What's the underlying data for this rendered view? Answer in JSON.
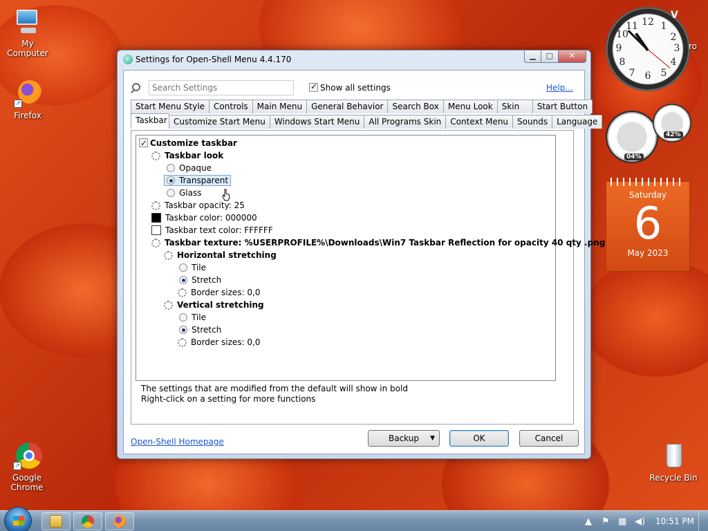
{
  "desktop": {
    "icons": {
      "my_computer": "My Computer",
      "firefox": "Firefox",
      "chrome": "Google Chrome",
      "recycle_bin": "Recycle Bin"
    }
  },
  "gadgets": {
    "clock": {
      "numbers": [
        "12",
        "1",
        "2",
        "3",
        "4",
        "5",
        "6",
        "7",
        "8",
        "9",
        "10",
        "11"
      ],
      "overlay_text": "V",
      "side_text": "ro"
    },
    "meters": {
      "cpu_percent": "04%",
      "memory_percent": "42%"
    },
    "calendar": {
      "weekday": "Saturday",
      "day": "6",
      "month_year": "May 2023"
    }
  },
  "dialog": {
    "title": "Settings for Open-Shell Menu 4.4.170",
    "window_buttons": {
      "minimize": "▁",
      "maximize": "□",
      "close": "✕"
    },
    "search": {
      "placeholder": "Search Settings"
    },
    "show_all": {
      "label": "Show all settings",
      "checked": true
    },
    "help": "Help...",
    "tabs_row1": [
      "Start Menu Style",
      "Controls",
      "Main Menu",
      "General Behavior",
      "Search Box",
      "Menu Look",
      "Skin",
      "Start Button"
    ],
    "tabs_row2": [
      "Taskbar",
      "Customize Start Menu",
      "Windows Start Menu",
      "All Programs Skin",
      "Context Menu",
      "Sounds",
      "Language"
    ],
    "active_tab": "Taskbar",
    "tree": {
      "customize_taskbar": "Customize taskbar",
      "taskbar_look": "Taskbar look",
      "opaque": "Opaque",
      "transparent": "Transparent",
      "glass": "Glass",
      "opacity": "Taskbar opacity: 25",
      "color": "Taskbar color: 000000",
      "text_color": "Taskbar text color: FFFFFF",
      "texture": "Taskbar texture: %USERPROFILE%\\Downloads\\Win7 Taskbar Reflection for opacity 40 qty .png",
      "horizontal": "Horizontal stretching",
      "h_tile": "Tile",
      "h_stretch": "Stretch",
      "h_border": "Border sizes: 0,0",
      "vertical": "Vertical stretching",
      "v_tile": "Tile",
      "v_stretch": "Stretch",
      "v_border": "Border sizes: 0,0"
    },
    "swatches": {
      "taskbar_color": "#000000",
      "text_color": "#FFFFFF"
    },
    "note1": "The settings that are modified from the default will show in bold",
    "note2": "Right-click on a setting for more functions",
    "homepage": "Open-Shell Homepage",
    "buttons": {
      "backup": "Backup",
      "ok": "OK",
      "cancel": "Cancel"
    }
  },
  "taskbar": {
    "time": "10:51 PM",
    "tray_icons": [
      "chevron-up-icon",
      "action-center-flag-icon",
      "network-icon",
      "speaker-icon"
    ]
  }
}
